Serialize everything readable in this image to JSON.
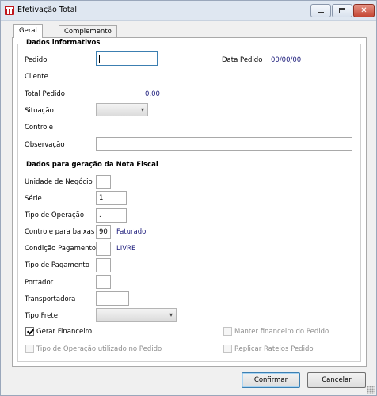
{
  "window": {
    "title": "Efetivação Total",
    "close_glyph": "✕"
  },
  "tabs": [
    {
      "label": "Geral",
      "active": true
    },
    {
      "label": "Complemento",
      "active": false
    }
  ],
  "dados_informativos": {
    "title": "Dados informativos",
    "pedido_label": "Pedido",
    "pedido_value": "",
    "data_pedido_label": "Data Pedido",
    "data_pedido_value": "00/00/00",
    "cliente_label": "Cliente",
    "total_pedido_label": "Total Pedido",
    "total_pedido_value": "0,00",
    "situacao_label": "Situação",
    "situacao_value": "",
    "controle_label": "Controle",
    "observacao_label": "Observação",
    "observacao_value": ""
  },
  "nota_fiscal": {
    "title": "Dados para geração da Nota Fiscal",
    "unidade_negocio_label": "Unidade de Negócio",
    "unidade_negocio_value": "",
    "serie_label": "Série",
    "serie_value": "1",
    "tipo_operacao_label": "Tipo de Operação",
    "tipo_operacao_value": ".",
    "controle_baixas_label": "Controle para baixas",
    "controle_baixas_value": "90",
    "controle_baixas_desc": "Faturado",
    "condicao_pagamento_label": "Condição Pagamento",
    "condicao_pagamento_value": "",
    "condicao_pagamento_desc": "LIVRE",
    "tipo_pagamento_label": "Tipo de Pagamento",
    "tipo_pagamento_value": "",
    "portador_label": "Portador",
    "portador_value": "",
    "transportadora_label": "Transportadora",
    "transportadora_value": "",
    "tipo_frete_label": "Tipo Frete",
    "tipo_frete_value": "",
    "gerar_financeiro_label": "Gerar Financeiro",
    "gerar_financeiro_checked": true,
    "manter_financeiro_label": "Manter financeiro do Pedido",
    "tipo_operacao_pedido_label": "Tipo de Operação utilizado no Pedido",
    "replicar_rateios_label": "Replicar Rateios Pedido"
  },
  "buttons": {
    "confirmar_u": "C",
    "confirmar_rest": "onfirmar",
    "cancelar_label": "Cancelar"
  },
  "icons": {
    "app": "app-logo-icon",
    "dropdown": "▾"
  },
  "colors": {
    "accent_value": "#1a1a7a",
    "focus_border": "#3c7fb1"
  }
}
